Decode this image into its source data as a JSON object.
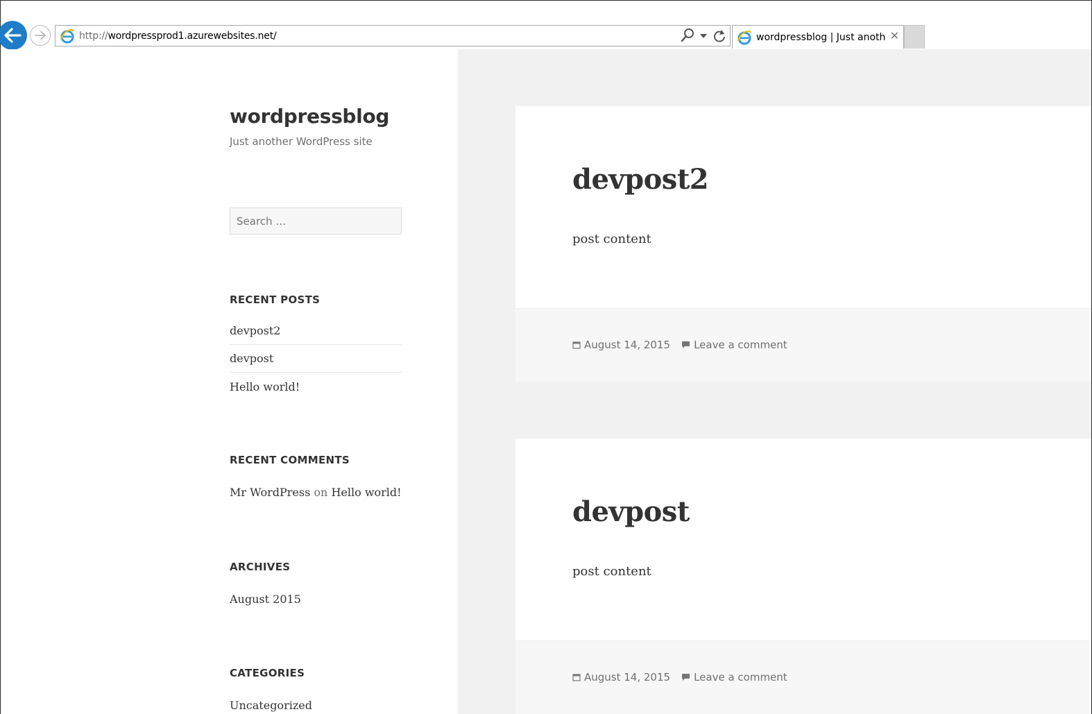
{
  "browser": {
    "url_protocol": "http://",
    "url_rest": "wordpressprod1.azurewebsites.net/",
    "tab_title": "wordpressblog | Just anoth...",
    "tab_close": "✕",
    "icons": [
      "back-arrow-icon",
      "forward-arrow-icon",
      "ie-logo-icon",
      "search-icon",
      "dropdown-arrow-icon",
      "refresh-icon"
    ]
  },
  "site": {
    "title": "wordpressblog",
    "description": "Just another WordPress site"
  },
  "sidebar": {
    "search_placeholder": "Search …",
    "recent_posts_title": "RECENT POSTS",
    "recent_posts": [
      "devpost2",
      "devpost",
      "Hello world!"
    ],
    "recent_comments_title": "RECENT COMMENTS",
    "recent_comment": {
      "author": "Mr WordPress",
      "on": "on",
      "post": "Hello world!"
    },
    "archives_title": "ARCHIVES",
    "archives": [
      "August 2015"
    ],
    "categories_title": "CATEGORIES",
    "categories": [
      "Uncategorized"
    ]
  },
  "posts": [
    {
      "title": "devpost2",
      "content": "post content",
      "date": "August 14, 2015",
      "comment_link": "Leave a comment"
    },
    {
      "title": "devpost",
      "content": "post content",
      "date": "August 14, 2015",
      "comment_link": "Leave a comment"
    }
  ],
  "colors": {
    "accent_back_button": "#1e7cc8",
    "text": "#333333",
    "muted": "#707070",
    "content_bg": "#f1f1f1"
  }
}
